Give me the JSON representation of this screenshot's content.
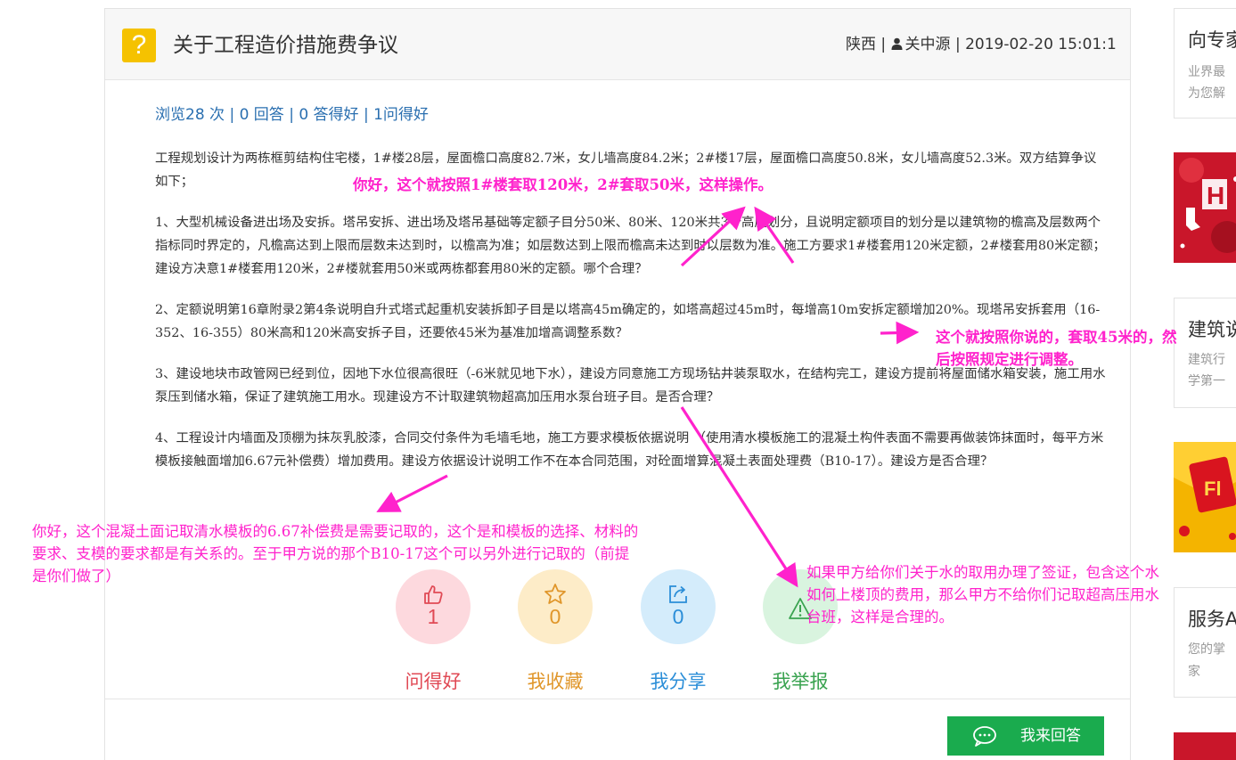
{
  "question": {
    "title": "关于工程造价措施费争议",
    "meta_prefix": "陕西 |",
    "user": "关中源",
    "meta_suffix": "| 2019-02-20 15:01:1",
    "stats": "浏览28 次 | 0 回答 | 0 答得好 | 1问得好",
    "paragraphs": [
      " 工程规划设计为两栋框剪结构住宅楼，1#楼28层，屋面檐口高度82.7米，女儿墙高度84.2米；2#楼17层，屋面檐口高度50.8米，女儿墙高度52.3米。双方结算争议如下；",
      "1、大型机械设备进出场及安拆。塔吊安拆、进出场及塔吊基础等定额子目分50米、80米、120米共3个高度划分，且说明定额项目的划分是以建筑物的檐高及层数两个指标同时界定的，凡檐高达到上限而层数未达到时，以檐高为准；如层数达到上限而檐高未达到时以层数为准。施工方要求1#楼套用120米定额，2#楼套用80米定额；建设方决意1#楼套用120米，2#楼就套用50米或两栋都套用80米的定额。哪个合理？",
      "2、定额说明第16章附录2第4条说明自升式塔式起重机安装拆卸子目是以塔高45m确定的，如塔高超过45m时，每增高10m安拆定额增加20%。现塔吊安拆套用（16-352、16-355）80米高和120米高安拆子目，还要依45米为基准加增高调整系数？",
      "3、建设地块市政管网已经到位，因地下水位很高很旺（-6米就见地下水），建设方同意施工方现场钻井装泵取水，在结构完工，建设方提前将屋面储水箱安装，施工用水泵压到储水箱，保证了建筑施工用水。现建设方不计取建筑物超高加压用水泵台班子目。是否合理？",
      "4、工程设计内墙面及顶棚为抹灰乳胶漆，合同交付条件为毛墙毛地，施工方要求模板依据说明 （使用清水模板施工的混凝土构件表面不需要再做装饰抹面时，每平方米模板接触面增加6.67元补偿费）增加费用。建设方依据设计说明工作不在本合同范围，对砼面增算混凝土表面处理费（B10-17）。建设方是否合理？"
    ]
  },
  "annotations": {
    "a1": "你好，这个就按照1#楼套取120米，2#套取50米，这样操作。",
    "a2_line1": "这个就按照你说的，套取45米的，然",
    "a2_line2": "后按照规定进行调整。",
    "a3_line1": "你好，这个混凝土面记取清水模板的6.67补偿费是需要记取的，这个是和模板的选择、材料的",
    "a3_line2": "要求、支模的要求都是有关系的。至于甲方说的那个B10-17这个可以另外进行记取的（前提",
    "a3_line3": "是你们做了）",
    "a4_line1": "如果甲方给你们关于水的取用办理了签证，包含这个水",
    "a4_line2": "如何上楼顶的费用，那么甲方不给你们记取超高压用水",
    "a4_line3": "台班，这样是合理的。"
  },
  "actions": [
    {
      "label": "问得好",
      "count": "1",
      "icon": "thumbs-up-icon",
      "bg": "#fdd9de",
      "color": "#e04a55"
    },
    {
      "label": "我收藏",
      "count": "0",
      "icon": "star-icon",
      "bg": "#fdecc8",
      "color": "#e0962a"
    },
    {
      "label": "我分享",
      "count": "0",
      "icon": "share-icon",
      "bg": "#d4ecfb",
      "color": "#2b8ed8"
    },
    {
      "label": "我举报",
      "count": "",
      "icon": "warning-icon",
      "bg": "#d9f4df",
      "color": "#3aa350"
    }
  ],
  "answer_button": "我来回答",
  "sidebar": {
    "card1_title": "向专家",
    "card1_sub1": "业界最",
    "card1_sub2": "为您解",
    "card2_title": "建筑说",
    "card2_sub1": "建筑行",
    "card2_sub2": "学第一",
    "card3_title": "服务A",
    "card3_sub1": "您的掌",
    "card3_sub2": "家"
  },
  "colors": {
    "annotation": "#ff22cc",
    "link_blue": "#2a6fb0",
    "answer_green": "#1aab4e",
    "question_icon": "#f5c200"
  }
}
